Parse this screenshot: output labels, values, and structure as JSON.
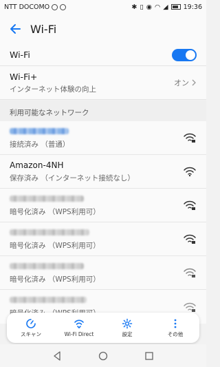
{
  "status_bar": {
    "carrier": "NTT DOCOMO",
    "time": "19:36"
  },
  "header": {
    "title": "Wi-Fi"
  },
  "settings": {
    "wifi_label": "Wi-Fi",
    "wifi_on": true,
    "wifiplus_label": "Wi-Fi+",
    "wifiplus_sub": "インターネット体験の向上",
    "wifiplus_value": "オン"
  },
  "section": {
    "available_networks": "利用可能なネットワーク"
  },
  "networks": [
    {
      "name": "",
      "status": "接続済み （普通）",
      "obscured": true,
      "connected": true,
      "locked": true
    },
    {
      "name": "Amazon-4NH",
      "status": "保存済み （インターネット接続なし）",
      "obscured": false,
      "locked": false
    },
    {
      "name": "",
      "status": "暗号化済み （WPS利用可）",
      "obscured": true,
      "locked": true
    },
    {
      "name": "",
      "status": "暗号化済み （WPS利用可）",
      "obscured": true,
      "locked": true
    },
    {
      "name": "",
      "status": "暗号化済み （WPS利用可）",
      "obscured": true,
      "locked": true
    },
    {
      "name": "",
      "status": "暗号化済み （WPS利用可）",
      "obscured": true,
      "locked": true
    }
  ],
  "bottom_actions": {
    "scan": "スキャン",
    "wifi_direct": "Wi-Fi Direct",
    "settings": "設定",
    "more": "その他"
  },
  "colors": {
    "accent": "#1878f2"
  }
}
